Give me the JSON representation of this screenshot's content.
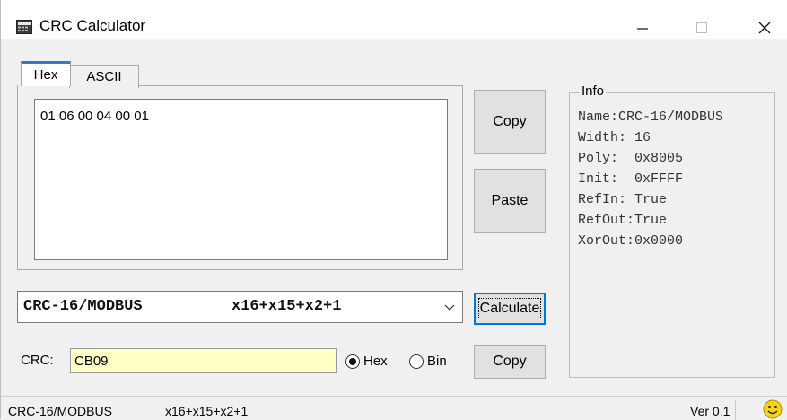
{
  "window": {
    "title": "CRC Calculator",
    "icon": "calculator-icon"
  },
  "tabs": [
    {
      "label": "Hex",
      "active": true
    },
    {
      "label": "ASCII",
      "active": false
    }
  ],
  "input": {
    "hex_value": "01 06 00 04 00 01"
  },
  "buttons": {
    "copy_top": "Copy",
    "paste": "Paste",
    "calculate": "Calculate",
    "copy_bottom": "Copy"
  },
  "info": {
    "label": "Info",
    "lines": [
      "Name:CRC-16/MODBUS",
      "Width: 16",
      "Poly:  0x8005",
      "Init:  0xFFFF",
      "RefIn: True",
      "RefOut:True",
      "XorOut:0x0000"
    ]
  },
  "algorithm_select": {
    "name": "CRC-16/MODBUS",
    "polynomial": "x16+x15+x2+1"
  },
  "crc": {
    "label": "CRC:",
    "value": "CB09",
    "format_options": [
      {
        "label": "Hex",
        "checked": true
      },
      {
        "label": "Bin",
        "checked": false
      }
    ]
  },
  "statusbar": {
    "name": "CRC-16/MODBUS",
    "polynomial": "x16+x15+x2+1",
    "version": "Ver 0.1",
    "icon": "smiley-icon"
  },
  "colors": {
    "tab_accent": "#2b7cd3",
    "crc_field_bg": "#ffffc6",
    "focus_border": "#0078d7"
  }
}
